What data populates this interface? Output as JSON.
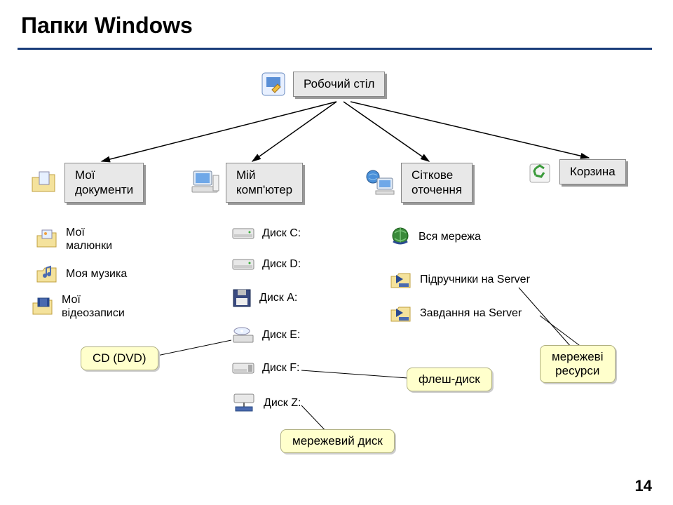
{
  "title": "Папки Windows",
  "root": {
    "label": "Робочий стіл"
  },
  "top_nodes": {
    "my_documents": "Мої\nдокументи",
    "my_computer": "Мій\nкомп'ютер",
    "network": "Сіткове\nоточення",
    "recycle": "Корзина"
  },
  "my_documents_children": {
    "pictures": "Мої\nмалюнки",
    "music": "Моя музика",
    "videos": "Мої\nвідеозаписи"
  },
  "my_computer_children": {
    "disk_c": "Диск C:",
    "disk_d": "Диск D:",
    "disk_a": "Диск A:",
    "disk_e": "Диск E:",
    "disk_f": "Диск F:",
    "disk_z": "Диск Z:"
  },
  "network_children": {
    "all_network": "Вся мережа",
    "textbooks": "Підручники на Server",
    "tasks": "Завдання на Server"
  },
  "callouts": {
    "cd_dvd": "CD (DVD)",
    "flash": "флеш-диск",
    "net_disk": "мережевий диск",
    "net_resources": "мережеві\nресурси"
  },
  "page_number": "14"
}
